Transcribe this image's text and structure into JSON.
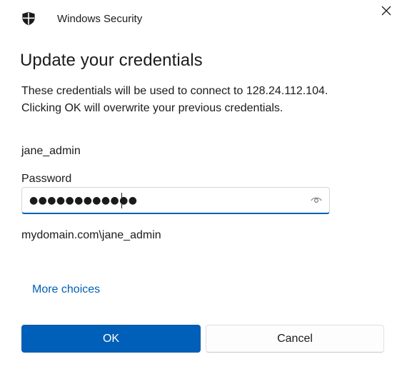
{
  "window": {
    "app_title": "Windows Security",
    "shield_icon": "shield-icon",
    "close_icon": "close-icon"
  },
  "dialog": {
    "heading": "Update your credentials",
    "description_line1": "These credentials will be used to connect to 128.24.112.104.",
    "description_line2": "Clicking OK will overwrite your previous credentials."
  },
  "credentials": {
    "username": "jane_admin",
    "password_label": "Password",
    "password_masked": "●●●●●●●●●●●●",
    "reveal_icon": "eye-icon",
    "domain_account": "mydomain.com\\jane_admin"
  },
  "links": {
    "more_choices": "More choices"
  },
  "buttons": {
    "ok_label": "OK",
    "cancel_label": "Cancel"
  },
  "colors": {
    "accent": "#005fb8",
    "text": "#1b1b1b",
    "background": "#ffffff"
  }
}
